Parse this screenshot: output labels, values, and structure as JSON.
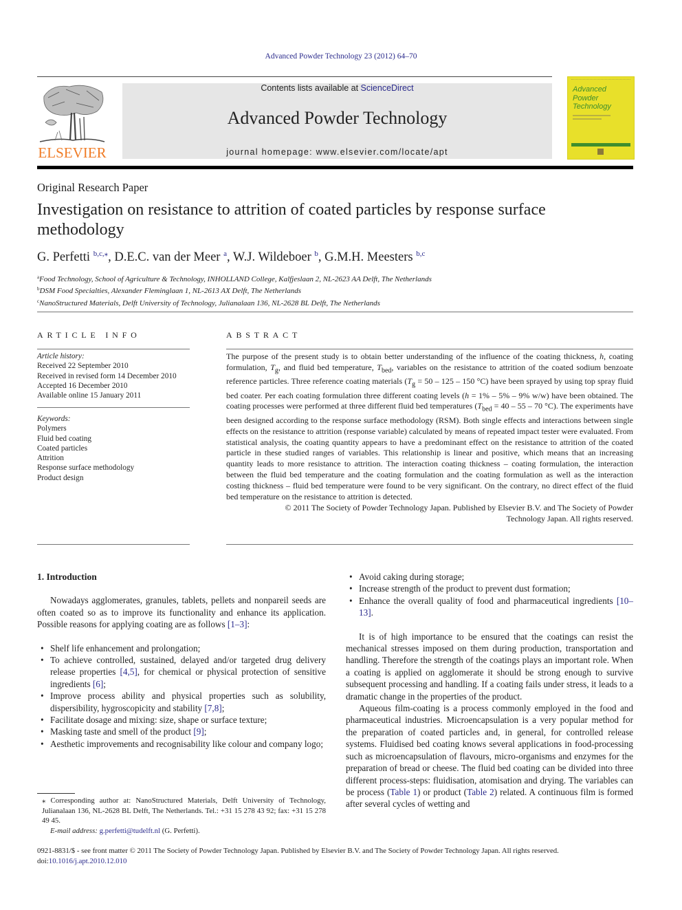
{
  "header": {
    "citation": "Advanced Powder Technology 23 (2012) 64–70",
    "contents_prefix": "Contents lists available at ",
    "contents_link": "ScienceDirect",
    "journal_title": "Advanced Powder Technology",
    "homepage": "journal homepage: www.elsevier.com/locate/apt",
    "publisher_logo_text": "ELSEVIER",
    "cover_title_lines": [
      "Advanced",
      "Powder",
      "Technology"
    ],
    "colors": {
      "link": "#2b2b8c",
      "elsevier_orange": "#f07c26",
      "cover_yellow": "#e8e02a",
      "cover_green": "#3e8e2d",
      "banner_gray": "#e6e6e6"
    }
  },
  "article": {
    "type": "Original Research Paper",
    "title": "Investigation on resistance to attrition of coated particles by response surface methodology",
    "authors": [
      {
        "name": "G. Perfetti",
        "sup": "b,c,⁎"
      },
      {
        "name": "D.E.C. van der Meer",
        "sup": "a"
      },
      {
        "name": "W.J. Wildeboer",
        "sup": "b"
      },
      {
        "name": "G.M.H. Meesters",
        "sup": "b,c"
      }
    ],
    "affiliations": [
      {
        "mark": "a",
        "text": "Food Technology, School of Agriculture & Technology, INHOLLAND College, Kalfjeslaan 2, NL-2623 AA Delft, The Netherlands"
      },
      {
        "mark": "b",
        "text": "DSM Food Specialties, Alexander Fleminglaan 1, NL-2613 AX Delft, The Netherlands"
      },
      {
        "mark": "c",
        "text": "NanoStructured Materials, Delft University of Technology, Julianalaan 136, NL-2628 BL Delft, The Netherlands"
      }
    ]
  },
  "article_info": {
    "heading": "ARTICLE INFO",
    "history_label": "Article history:",
    "history": [
      "Received 22 September 2010",
      "Received in revised form 14 December 2010",
      "Accepted 16 December 2010",
      "Available online 15 January 2011"
    ],
    "keywords_label": "Keywords:",
    "keywords": [
      "Polymers",
      "Fluid bed coating",
      "Coated particles",
      "Attrition",
      "Response surface methodology",
      "Product design"
    ]
  },
  "abstract": {
    "heading": "ABSTRACT",
    "s1": "The purpose of the present study is to obtain better understanding of the influence of the coating thickness, ",
    "h": "h",
    "s2": ", coating formulation, ",
    "Tg_T": "T",
    "Tg_sub": "g",
    "s3": ", and fluid bed temperature, ",
    "Tbed_T": "T",
    "Tbed_sub": "bed",
    "s4": ", variables on the resistance to attrition of the coated sodium benzoate reference particles. Three reference coating materials (",
    "s5": " = 50 – 125 – 150 °C) have been sprayed by using top spray fluid bed coater. Per each coating formulation three different coating levels (",
    "s6": " = 1% – 5% – 9% w/w) have been obtained. The coating processes were performed at three different fluid bed temperatures (",
    "s7": " = 40 – 55 – 70 °C). The experiments have been designed according to the response surface methodology (RSM). Both single effects and interactions between single effects on the resistance to attrition (response variable) calculated by means of repeated impact tester were evaluated. From statistical analysis, the coating quantity appears to have a predominant effect on the resistance to attrition of the coated particle in these studied ranges of variables. This relationship is linear and positive, which means that an increasing quantity leads to more resistance to attrition. The interaction coating thickness – coating formulation, the interaction between the fluid bed temperature and the coating formulation and the coating formulation as well as the interaction costing thickness – fluid bed temperature were found to be very significant. On the contrary, no direct effect of the fluid bed temperature on the resistance to attrition is detected.",
    "copyright_1": "© 2011 The Society of Powder Technology Japan. Published by Elsevier B.V. and The Society of Powder",
    "copyright_2": "Technology Japan. All rights reserved."
  },
  "body": {
    "section_heading": "1. Introduction",
    "intro_para": "Nowadays agglomerates, granules, tablets, pellets and nonpareil seeds are often coated so as to improve its functionality and enhance its application. Possible reasons for applying coating are as follows ",
    "intro_ref": "[1–3]",
    "bullets_left": [
      {
        "text": "Shelf life enhancement and prolongation;"
      },
      {
        "pre": "To achieve controlled, sustained, delayed and/or targeted drug delivery release properties ",
        "ref": "[4,5]",
        "mid": ", for chemical or physical protection of sensitive ingredients ",
        "ref2": "[6]",
        "post": ";"
      },
      {
        "pre": "Improve process ability and physical properties such as solubility, dispersibility, hygroscopicity and stability ",
        "ref": "[7,8]",
        "post": ";"
      },
      {
        "text": "Facilitate dosage and mixing: size, shape or surface texture;"
      },
      {
        "pre": "Masking taste and smell of the product ",
        "ref": "[9]",
        "post": ";"
      },
      {
        "text": "Aesthetic improvements and recognisability like colour and company logo;"
      }
    ],
    "bullets_right": [
      {
        "text": "Avoid caking during storage;"
      },
      {
        "text": "Increase strength of the product to prevent dust formation;"
      },
      {
        "pre": "Enhance the overall quality of food and pharmaceutical ingredients ",
        "ref": "[10–13]",
        "post": "."
      }
    ],
    "para2": "It is of high importance to be ensured that the coatings can resist the mechanical stresses imposed on them during production, transportation and handling. Therefore the strength of the coatings plays an important role. When a coating is applied on agglomerate it should be strong enough to survive subsequent processing and handling. If a coating fails under stress, it leads to a dramatic change in the properties of the product.",
    "para3_pre": "Aqueous film-coating is a process commonly employed in the food and pharmaceutical industries. Microencapsulation is a very popular method for the preparation of coated particles and, in general, for controlled release systems. Fluidised bed coating knows several applications in food-processing such as microencapsulation of flavours, micro-organisms and enzymes for the preparation of bread or cheese. The fluid bed coating can be divided into three different process-steps: fluidisation, atomisation and drying. The variables can be process (",
    "table1": "Table 1",
    "para3_mid": ") or product (",
    "table2": "Table 2",
    "para3_post": ") related. A continuous film is formed after several cycles of wetting and"
  },
  "footnote": {
    "corresponding": "⁎ Corresponding author at: NanoStructured Materials, Delft University of Technology, Julianalaan 136, NL-2628 BL Delft, The Netherlands. Tel.: +31 15 278 43 92; fax: +31 15 278 49 45.",
    "email_label": "E-mail address:",
    "email": "g.perfetti@tudelft.nl",
    "email_suffix": " (G. Perfetti)."
  },
  "bottom": {
    "front_matter": "0921-8831/$ - see front matter © 2011 The Society of Powder Technology Japan. Published by Elsevier B.V. and The Society of Powder Technology Japan. All rights reserved.",
    "doi_label": "doi:",
    "doi": "10.1016/j.apt.2010.12.010"
  }
}
